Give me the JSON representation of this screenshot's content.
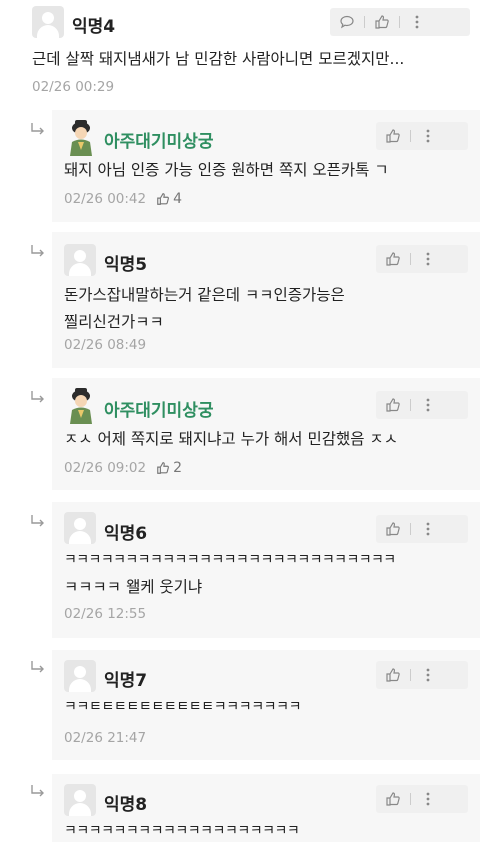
{
  "comments": [
    {
      "author": "익명4",
      "text": [
        "근데 살짝 돼지냄새가 남 민감한 사람아니면 모르겠지만..."
      ],
      "time": "02/26 00:29",
      "likes": ""
    },
    {
      "author": "아주대기미상궁",
      "text": [
        "돼지 아님 인증 가능 인증 원하면 쪽지 오픈카톡 ㄱ"
      ],
      "time": "02/26 00:42",
      "likes": "4"
    },
    {
      "author": "익명5",
      "text": [
        "돈가스잡내말하는거 같은데 ㅋㅋ인증가능은",
        "찔리신건가ㅋㅋ"
      ],
      "time": "02/26 08:49",
      "likes": ""
    },
    {
      "author": "아주대기미상궁",
      "text": [
        "ㅈㅅ 어제 쪽지로 돼지냐고 누가 해서 민감했음 ㅈㅅ"
      ],
      "time": "02/26 09:02",
      "likes": "2"
    },
    {
      "author": "익명6",
      "text": [
        "ㅋㅋㅋㅋㅋㅋㅋㅋㅋㅋㅋㅋㅋㅋㅋㅋㅋㅋㅋㅋㅋㅋㅋㅋㅋㅋㅋ",
        "ㅋㅋㅋㅋ 왤케 웃기냐"
      ],
      "time": "02/26 12:55",
      "likes": ""
    },
    {
      "author": "익명7",
      "text": [
        "ㅋㅋㅌㅌㅌㅌㅌㅌㅌㅌㅌㅌㅋㅋㅋㅋㅋㅋㅋ"
      ],
      "time": "02/26 21:47",
      "likes": ""
    },
    {
      "author": "익명8",
      "text": [
        "ㅋㅋㅋㅋㅋㅋㅋㅋㅋㅋㅋㅋㅋㅋㅋㅋㅋㅋㅋ"
      ],
      "time": "",
      "likes": ""
    }
  ],
  "icons": {
    "reply": "chat-bubble-icon",
    "like": "thumbs-up-icon",
    "more": "more-vertical-icon",
    "arrow": "reply-arrow-icon"
  },
  "colors": {
    "special_author": "#2f8f61",
    "time": "#a5a5a5",
    "reply_bg": "#f7f7f7"
  }
}
